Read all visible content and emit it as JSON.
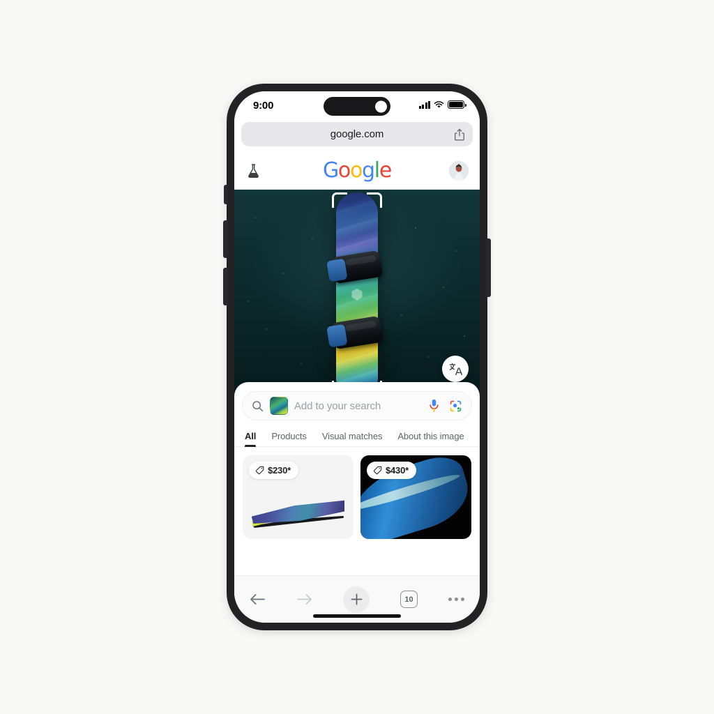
{
  "device": {
    "status_bar": {
      "time": "9:00",
      "signal_icon": "cellular-signal-icon",
      "wifi_icon": "wifi-icon",
      "battery_icon": "battery-full-icon"
    },
    "home_indicator": "home-indicator"
  },
  "browser": {
    "url": "google.com",
    "share_icon": "share-icon",
    "bottom_bar": {
      "back_icon": "back-arrow-icon",
      "forward_icon": "forward-arrow-icon",
      "new_tab_icon": "plus-icon",
      "tab_count": "10",
      "more_icon": "more-dots-icon"
    }
  },
  "google_header": {
    "lab_icon": "lab-flask-icon",
    "logo_letters": [
      "G",
      "o",
      "o",
      "g",
      "l",
      "e"
    ],
    "avatar": "user-avatar"
  },
  "viewport": {
    "background_color": "#0c2a2d",
    "subject": "snowboard",
    "crop_selection": "crop-selection-frame",
    "translate_button_label": "translate-icon"
  },
  "lens_sheet": {
    "search": {
      "search_icon": "magnifier-icon",
      "thumbnail": "image-thumbnail",
      "placeholder": "Add to your search",
      "mic_icon": "microphone-icon",
      "lens_icon": "google-lens-icon"
    },
    "tabs": [
      {
        "label": "All",
        "active": true
      },
      {
        "label": "Products",
        "active": false
      },
      {
        "label": "Visual matches",
        "active": false
      },
      {
        "label": "About this image",
        "active": false
      }
    ],
    "results": [
      {
        "price": "$230*",
        "tag_icon": "price-tag-icon",
        "image": "snowboard-angled-view"
      },
      {
        "price": "$430*",
        "tag_icon": "price-tag-icon",
        "image": "snowboard-tip-closeup"
      }
    ]
  },
  "colors": {
    "google_blue": "#4285F4",
    "google_red": "#EA4335",
    "google_yellow": "#FBBC05",
    "google_green": "#34A853",
    "viewport_bg": "#0c2a2d",
    "sheet_bg": "#ffffff"
  }
}
